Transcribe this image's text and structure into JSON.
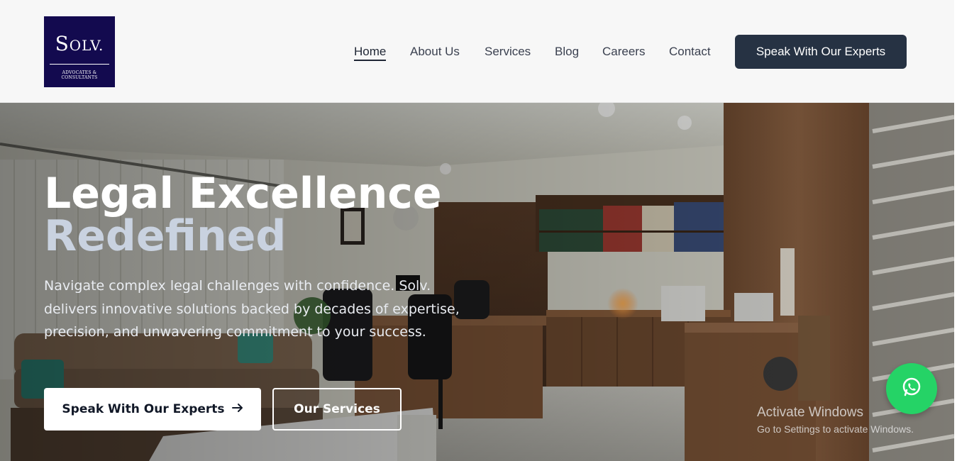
{
  "logo": {
    "initial": "S",
    "rest": "OLV.",
    "tagline": "ADVOCATES & CONSULTANTS"
  },
  "nav": {
    "items": [
      {
        "label": "Home",
        "active": true
      },
      {
        "label": "About Us",
        "active": false
      },
      {
        "label": "Services",
        "active": false
      },
      {
        "label": "Blog",
        "active": false
      },
      {
        "label": "Careers",
        "active": false
      },
      {
        "label": "Contact",
        "active": false
      }
    ],
    "cta_label": "Speak With Our Experts"
  },
  "hero": {
    "title_line1": "Legal Excellence",
    "title_line2": "Redefined",
    "description": "Navigate complex legal challenges with confidence. Solv. delivers innovative solutions backed by decades of expertise, precision, and unwavering commitment to your success.",
    "primary_button": "Speak With Our Experts",
    "secondary_button": "Our Services"
  },
  "whatsapp": {
    "icon": "whatsapp-icon"
  },
  "windows_watermark": {
    "title": "Activate Windows",
    "subtitle": "Go to Settings to activate Windows."
  },
  "colors": {
    "brand_navy": "#130a4f",
    "header_cta": "#263243",
    "title_secondary": "#c9d2e0",
    "whatsapp_green": "#25d366"
  }
}
